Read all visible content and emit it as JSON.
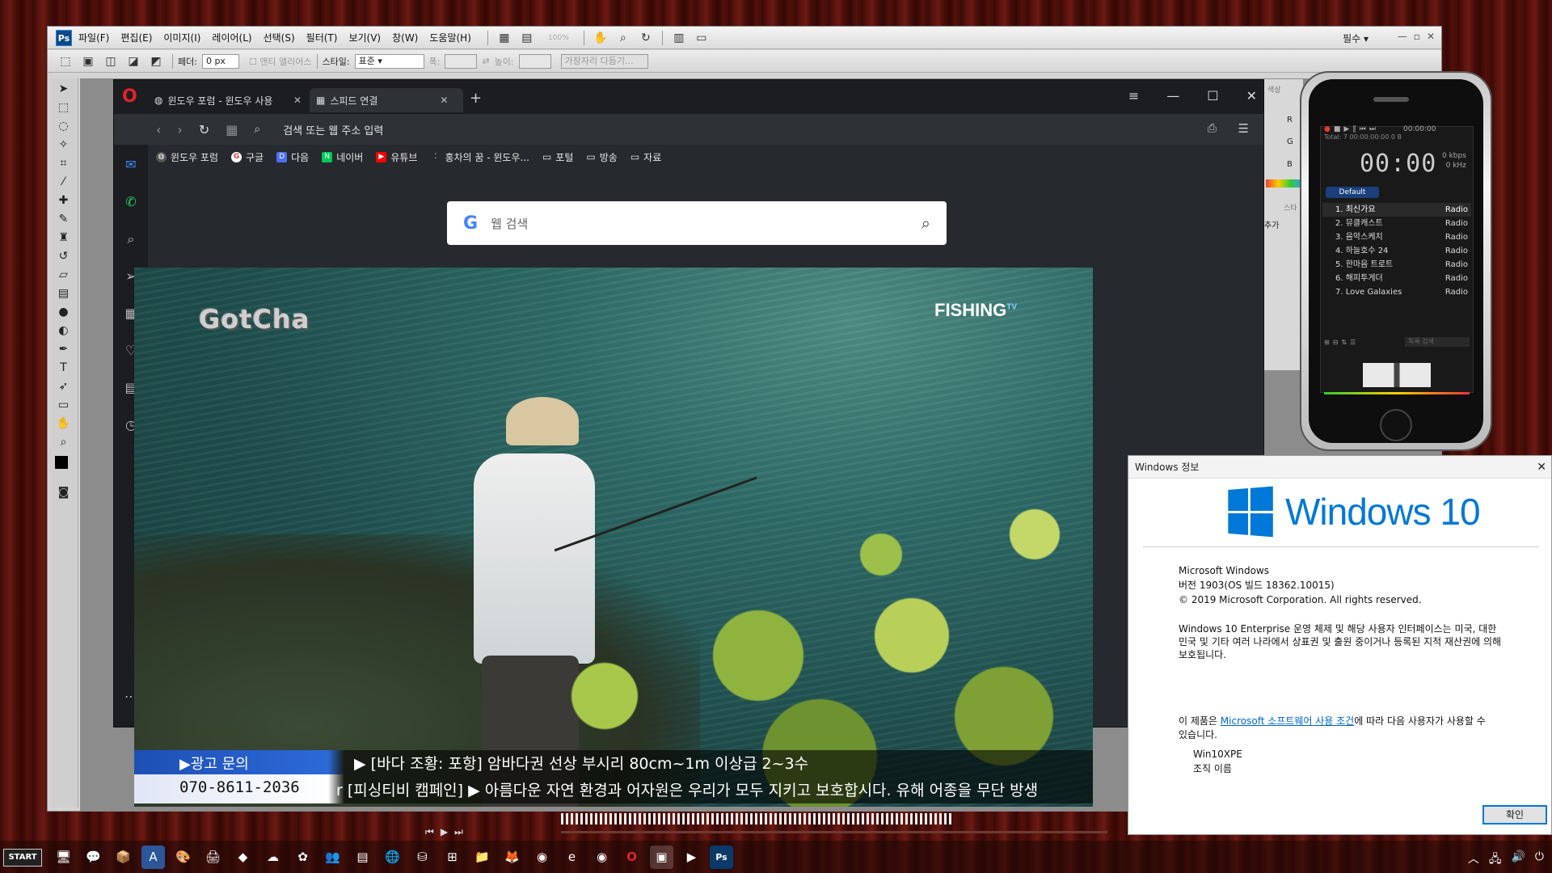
{
  "photoshop": {
    "menus": [
      "파일(F)",
      "편집(E)",
      "이미지(I)",
      "레이어(L)",
      "선택(S)",
      "필터(T)",
      "보기(V)",
      "창(W)",
      "도움말(H)"
    ],
    "zoom": "100%",
    "workspace": "필수",
    "options": {
      "feather_label": "페더:",
      "feather_value": "0 px",
      "antialias_label": "앤티 앨리어스",
      "style_label": "스타일:",
      "style_value": "표준",
      "width_label": "폭:",
      "height_label": "높이:",
      "refine_label": "가장자리 다듬기..."
    },
    "panel_text": {
      "add": "추가",
      "swatch": "색상",
      "swatch2": "스타"
    }
  },
  "browser": {
    "tabs": [
      {
        "label": "윈도우 포럼 - 윈도우 사용",
        "active": false
      },
      {
        "label": "스피드 연결",
        "active": true
      }
    ],
    "address_placeholder": "검색 또는 웹 주소 입력",
    "bookmarks": [
      {
        "label": "윈도우 포럼",
        "icon": "forum-icon",
        "color": "#666"
      },
      {
        "label": "구글",
        "icon": "google-icon",
        "color": "#ea4335"
      },
      {
        "label": "다음",
        "icon": "daum-icon",
        "color": "#4b6ef5"
      },
      {
        "label": "네이버",
        "icon": "naver-icon",
        "color": "#03c75a"
      },
      {
        "label": "유튜브",
        "icon": "youtube-icon",
        "color": "#ff0000"
      },
      {
        "label": "홍차의 꿈 - 윈도우...",
        "icon": "tea-icon",
        "color": "#888"
      },
      {
        "label": "포털",
        "icon": "folder-icon",
        "color": "transparent"
      },
      {
        "label": "방송",
        "icon": "folder-icon",
        "color": "transparent"
      },
      {
        "label": "자료",
        "icon": "folder-icon",
        "color": "transparent"
      }
    ],
    "search_placeholder": "웹 검색"
  },
  "video": {
    "watermark_left": "GotCha",
    "watermark_right": "FISHING",
    "watermark_right_sup": "TV",
    "ad_label": "▶광고 문의",
    "phone": "070-8611-2036",
    "ticker1": "▶ [바다 조황: 포항] 암바다권 선상 부시리 80cm~1m 이상급 2~3수",
    "ticker2": "r  [피싱티비 캠페인]  ▶ 아름다운 자연 환경과 어자원은 우리가 모두 지키고 보호합시다. 유해 어종을 무단 방생"
  },
  "player": {
    "time": "00:00",
    "total": "Total:   7     00:00:00:00      0 B",
    "kbps": "0 kbps",
    "khz": "0 kHz",
    "header_time": "00:00:00",
    "playlist_tab": "Default",
    "playlist": [
      {
        "title": "1. 최신가요",
        "type": "Radio"
      },
      {
        "title": "2. 뮤클캐스트",
        "type": "Radio"
      },
      {
        "title": "3. 음악스케치",
        "type": "Radio"
      },
      {
        "title": "4. 하늘호수 24",
        "type": "Radio"
      },
      {
        "title": "5. 한마음 트로트",
        "type": "Radio"
      },
      {
        "title": "6. 해피투게더",
        "type": "Radio"
      },
      {
        "title": "7. Love Galaxies",
        "type": "Radio"
      }
    ],
    "search_placeholder": "목록 검색"
  },
  "winver": {
    "title": "Windows 정보",
    "brand": "Windows 10",
    "line1": "Microsoft Windows",
    "line2": "버전 1903(OS 빌드 18362.10015)",
    "line3": "© 2019 Microsoft Corporation. All rights reserved.",
    "legal": "Windows 10 Enterprise 운영 체제 및 해당 사용자 인터페이스는 미국, 대한민국 및 기타 여러 나라에서 상표권 및 출원 중이거나 등록된 지적 재산권에 의해 보호됩니다.",
    "license_pre": "이 제품은 ",
    "license_link": "Microsoft 소프트웨어 사용 조건",
    "license_post": "에 따라 다음 사용자가 사용할 수 있습니다.",
    "user": "Win10XPE",
    "org": "조직 이름",
    "ok": "확인"
  },
  "taskbar": {
    "start": "START",
    "apps": [
      {
        "icon": "explorer-icon",
        "glyph": "🖥"
      },
      {
        "icon": "kakaotalk-icon",
        "glyph": "💬"
      },
      {
        "icon": "archive-icon",
        "glyph": "📦"
      },
      {
        "icon": "word-icon",
        "glyph": "A"
      },
      {
        "icon": "paint-icon",
        "glyph": "🎨"
      },
      {
        "icon": "device-icon",
        "glyph": "🖨"
      },
      {
        "icon": "tool-icon",
        "glyph": "◆"
      },
      {
        "icon": "network-icon",
        "glyph": "☁"
      },
      {
        "icon": "puzzle-icon",
        "glyph": "✿"
      },
      {
        "icon": "users-icon",
        "glyph": "👥"
      },
      {
        "icon": "copy-icon",
        "glyph": "▤"
      },
      {
        "icon": "globe-icon",
        "glyph": "🌐"
      },
      {
        "icon": "disk-icon",
        "glyph": "⛁"
      },
      {
        "icon": "windows-icon",
        "glyph": "⊞"
      },
      {
        "icon": "folder-icon",
        "glyph": "📁"
      },
      {
        "icon": "firefox-icon",
        "glyph": "🦊"
      },
      {
        "icon": "chrome-icon",
        "glyph": "◉"
      },
      {
        "icon": "edge-icon",
        "glyph": "e"
      },
      {
        "icon": "chrome2-icon",
        "glyph": "◉"
      },
      {
        "icon": "opera-icon",
        "glyph": "O"
      },
      {
        "icon": "window-icon",
        "glyph": "▣"
      },
      {
        "icon": "player-icon",
        "glyph": "▶"
      },
      {
        "icon": "photoshop-icon",
        "glyph": "Ps"
      }
    ]
  }
}
